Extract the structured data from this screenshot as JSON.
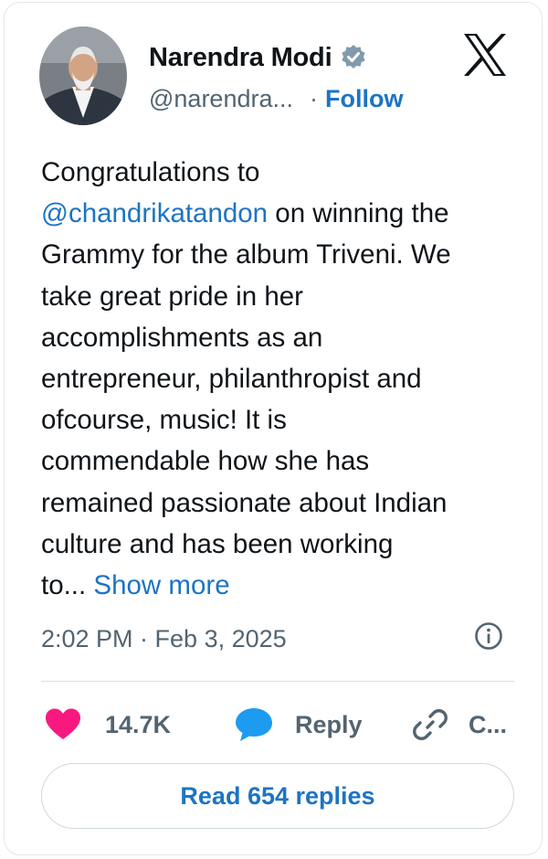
{
  "author": {
    "name": "Narendra Modi",
    "handle": "@narendra...",
    "follow_label": "Follow",
    "verified": true
  },
  "tweet": {
    "lines": [
      {
        "before": "Congratulations to",
        "mention": "",
        "after": ""
      },
      {
        "before": "",
        "mention": "@chandrikatandon",
        "after": " on winning the"
      },
      {
        "before": "Grammy for the album Triveni. We",
        "mention": "",
        "after": ""
      },
      {
        "before": "take great pride in her",
        "mention": "",
        "after": ""
      },
      {
        "before": "accomplishments as an",
        "mention": "",
        "after": ""
      },
      {
        "before": "entrepreneur, philanthropist and",
        "mention": "",
        "after": ""
      },
      {
        "before": "ofcourse, music! It is",
        "mention": "",
        "after": ""
      },
      {
        "before": "commendable how she has",
        "mention": "",
        "after": ""
      },
      {
        "before": "remained passionate about Indian",
        "mention": "",
        "after": ""
      },
      {
        "before": "culture and has been working",
        "mention": "",
        "after": ""
      },
      {
        "before": "to...",
        "mention": "",
        "after": ""
      }
    ],
    "show_more_label": "Show more",
    "timestamp": "2:02 PM · Feb 3, 2025"
  },
  "actions": {
    "like_count": "14.7K",
    "reply_label": "Reply",
    "copy_label": "C..."
  },
  "read_replies_label": "Read 654 replies",
  "icons": {
    "verified": "verified-badge-icon",
    "x_logo": "x-logo-icon",
    "info": "info-icon",
    "like": "heart-icon",
    "reply": "speech-bubble-icon",
    "copy": "link-icon"
  },
  "colors": {
    "text": "#0f1419",
    "secondary": "#536471",
    "link": "#1d74c4",
    "like": "#f91880",
    "reply": "#1d9bf0",
    "verified": "#829aab"
  }
}
